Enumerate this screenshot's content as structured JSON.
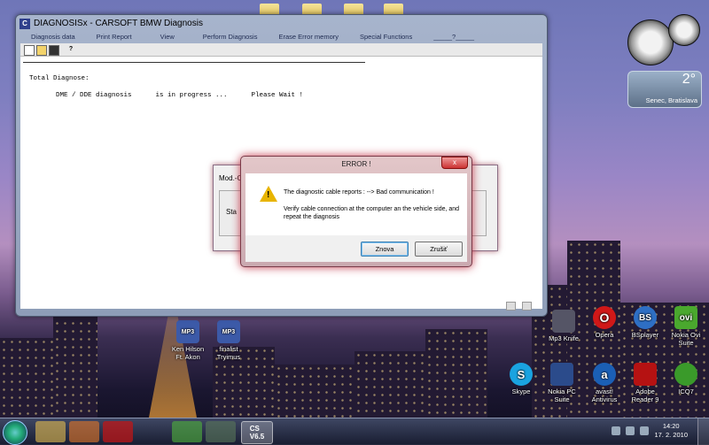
{
  "main_window": {
    "title": "DIAGNOSISx - CARSOFT BMW Diagnosis",
    "app_icon": "C",
    "menu": [
      "Diagnosis data",
      "Print Report",
      "View",
      "Perform Diagnosis",
      "Erase Error memory",
      "Special Functions",
      "_____?_____"
    ],
    "toolbar_icons": [
      "new-icon",
      "open-icon",
      "save-icon",
      "help-icon"
    ],
    "content": {
      "line1": "Total Diagnose:",
      "line2": "DME / DDE diagnosis      is in progress ...      Please Wait !"
    }
  },
  "background_dialog": {
    "title": "Mod.-C",
    "status": "Sta"
  },
  "error_dialog": {
    "title": "ERROR  !",
    "close": "x",
    "message": "The diagnostic cable reports : --> Bad communication !",
    "detail": "Verify cable connection at the computer an the vehicle side, and repeat the diagnosis",
    "buttons": {
      "ok": "Znova",
      "cancel": "Zrušiť"
    }
  },
  "weather_gadget": {
    "temperature": "2°",
    "location": "Senec, Bratislava"
  },
  "desktop_icons": [
    {
      "label": "Ken Hilson Ft. Akon",
      "badge": "MP3"
    },
    {
      "label": "finalist Tryimus",
      "badge": "MP3"
    },
    {
      "label": "Mp3 Knife",
      "badge": ""
    },
    {
      "label": "Opera",
      "badge": "O"
    },
    {
      "label": "BSplayer",
      "badge": "BS"
    },
    {
      "label": "Nokia Ovi Suite",
      "badge": "ovi"
    },
    {
      "label": "Skype",
      "badge": "S"
    },
    {
      "label": "Nokia PC Suite",
      "badge": ""
    },
    {
      "label": "avast! Antivirus",
      "badge": "a"
    },
    {
      "label": "Adobe Reader 9",
      "badge": ""
    },
    {
      "label": "ICQ7",
      "badge": ""
    }
  ],
  "taskbar": {
    "apps": [
      "explorer",
      "media-player",
      "opera",
      "icq",
      "network",
      "CS V6.5"
    ],
    "active_app_label": "CS\nV6.5",
    "clock_time": "14:20",
    "clock_date": "17. 2. 2010"
  },
  "colors": {
    "error_glow": "#c8283c",
    "window_frame": "#a7b4cc",
    "warning": "#e8b400"
  }
}
